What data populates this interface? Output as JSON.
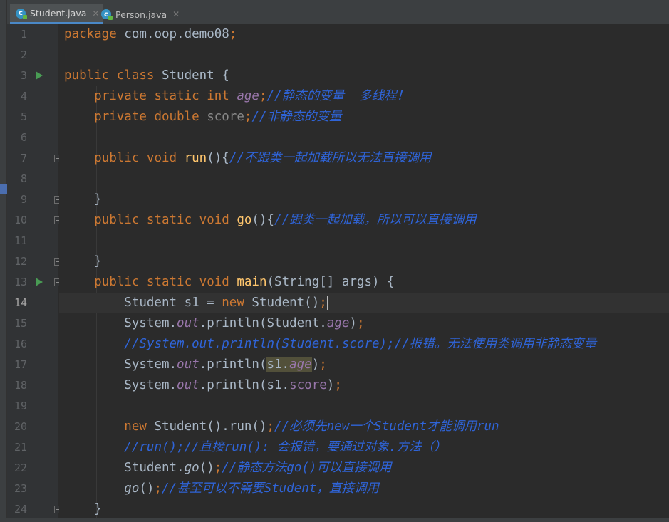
{
  "tabs": [
    {
      "label": "Student.java",
      "active": true,
      "icon": "java-class-icon"
    },
    {
      "label": "Person.java",
      "active": false,
      "icon": "java-class-icon"
    }
  ],
  "current_line": "14",
  "run_markers": [
    "3",
    "13"
  ],
  "lines": [
    {
      "num": "1",
      "segs": [
        [
          "kw",
          "package "
        ],
        [
          "t",
          "com.oop.demo08"
        ],
        [
          "kw",
          ";"
        ]
      ]
    },
    {
      "num": "2",
      "segs": []
    },
    {
      "num": "3",
      "segs": [
        [
          "kw",
          "public class "
        ],
        [
          "t",
          "Student {"
        ]
      ]
    },
    {
      "num": "4",
      "segs": [
        [
          "t",
          "    "
        ],
        [
          "kw",
          "private static int "
        ],
        [
          "ifld",
          "age"
        ],
        [
          "kw",
          ";"
        ],
        [
          "cmt",
          "//静态的变量  多线程！"
        ]
      ]
    },
    {
      "num": "5",
      "segs": [
        [
          "t",
          "    "
        ],
        [
          "kw",
          "private double "
        ],
        [
          "dim",
          "score"
        ],
        [
          "kw",
          ";"
        ],
        [
          "cmt",
          "//非静态的变量"
        ]
      ]
    },
    {
      "num": "6",
      "segs": []
    },
    {
      "num": "7",
      "segs": [
        [
          "t",
          "    "
        ],
        [
          "kw",
          "public void "
        ],
        [
          "fn",
          "run"
        ],
        [
          "t",
          "(){"
        ],
        [
          "cmt",
          "//不跟类一起加载所以无法直接调用"
        ]
      ]
    },
    {
      "num": "8",
      "segs": []
    },
    {
      "num": "9",
      "segs": [
        [
          "t",
          "    }"
        ]
      ]
    },
    {
      "num": "10",
      "segs": [
        [
          "t",
          "    "
        ],
        [
          "kw",
          "public static void "
        ],
        [
          "fn",
          "go"
        ],
        [
          "t",
          "(){"
        ],
        [
          "cmt",
          "//跟类一起加载，所以可以直接调用"
        ]
      ]
    },
    {
      "num": "11",
      "segs": []
    },
    {
      "num": "12",
      "segs": [
        [
          "t",
          "    }"
        ]
      ]
    },
    {
      "num": "13",
      "segs": [
        [
          "t",
          "    "
        ],
        [
          "kw",
          "public static void "
        ],
        [
          "fn",
          "main"
        ],
        [
          "t",
          "(String[] args) {"
        ]
      ]
    },
    {
      "num": "14",
      "segs": [
        [
          "t",
          "        Student s1 = "
        ],
        [
          "kw",
          "new "
        ],
        [
          "t",
          "Student()"
        ],
        [
          "kw",
          ";"
        ],
        [
          "caret",
          ""
        ]
      ]
    },
    {
      "num": "15",
      "segs": [
        [
          "t",
          "        System."
        ],
        [
          "ifld",
          "out"
        ],
        [
          "t",
          ".println(Student."
        ],
        [
          "ifld",
          "age"
        ],
        [
          "t",
          ")"
        ],
        [
          "kw",
          ";"
        ]
      ]
    },
    {
      "num": "16",
      "segs": [
        [
          "t",
          "        "
        ],
        [
          "cmt",
          "//System.out.println(Student.score);//报错。无法使用类调用非静态变量"
        ]
      ]
    },
    {
      "num": "17",
      "segs": [
        [
          "t",
          "        System."
        ],
        [
          "ifld",
          "out"
        ],
        [
          "t",
          ".println("
        ],
        [
          "hl",
          "s1."
        ],
        [
          "hlfld",
          "age"
        ],
        [
          "t",
          ")"
        ],
        [
          "kw",
          ";"
        ]
      ]
    },
    {
      "num": "18",
      "segs": [
        [
          "t",
          "        System."
        ],
        [
          "ifld",
          "out"
        ],
        [
          "t",
          ".println(s1."
        ],
        [
          "fld",
          "score"
        ],
        [
          "t",
          ")"
        ],
        [
          "kw",
          ";"
        ]
      ]
    },
    {
      "num": "19",
      "segs": []
    },
    {
      "num": "20",
      "segs": [
        [
          "t",
          "        "
        ],
        [
          "kw",
          "new "
        ],
        [
          "t",
          "Student().run()"
        ],
        [
          "kw",
          ";"
        ],
        [
          "cmt",
          "//必须先new一个Student才能调用run"
        ]
      ]
    },
    {
      "num": "21",
      "segs": [
        [
          "t",
          "        "
        ],
        [
          "cmt",
          "//run();//直接run(): 会报错，要通过对象.方法（）"
        ]
      ]
    },
    {
      "num": "22",
      "segs": [
        [
          "t",
          "        Student."
        ],
        [
          "ifn",
          "go"
        ],
        [
          "t",
          "()"
        ],
        [
          "kw",
          ";"
        ],
        [
          "cmt",
          "//静态方法go()可以直接调用"
        ]
      ]
    },
    {
      "num": "23",
      "segs": [
        [
          "t",
          "        "
        ],
        [
          "ifn",
          "go"
        ],
        [
          "t",
          "()"
        ],
        [
          "kw",
          ";"
        ],
        [
          "cmt",
          "//甚至可以不需要Student，直接调用"
        ]
      ]
    },
    {
      "num": "24",
      "segs": [
        [
          "t",
          "    }"
        ]
      ]
    }
  ],
  "colors": {
    "background": "#2b2b2b",
    "keyword": "#cc7832",
    "method": "#ffc66d",
    "field": "#9876aa",
    "comment": "#2f64d8",
    "text": "#a9b7c6"
  }
}
